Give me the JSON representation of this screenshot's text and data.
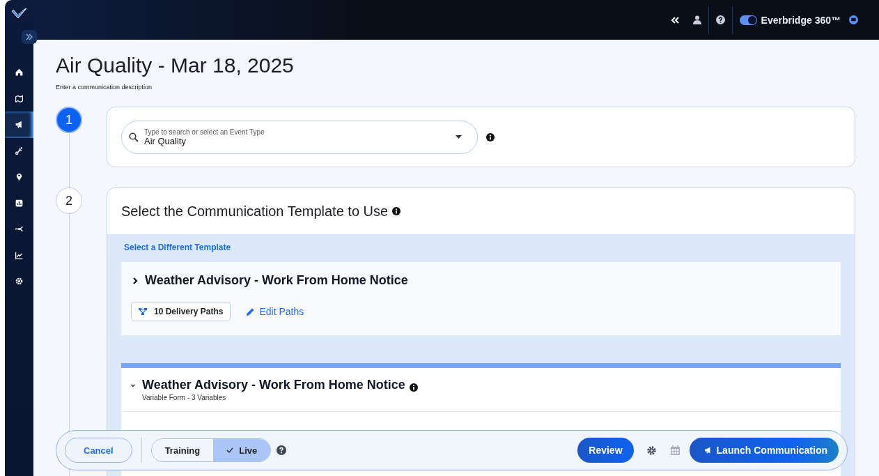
{
  "top_bar": {
    "product": "Everbridge 360™",
    "product_toggle_on": true
  },
  "sidebar": {
    "items": [
      {
        "selected": false
      },
      {
        "selected": false
      },
      {
        "selected": true
      },
      {
        "selected": false
      },
      {
        "selected": false
      },
      {
        "selected": false
      },
      {
        "selected": false
      },
      {
        "selected": false
      },
      {
        "selected": false
      }
    ]
  },
  "page": {
    "title": "Air Quality - Mar 18, 2025",
    "description": "Enter a communication description"
  },
  "steps": [
    {
      "number": "1",
      "selected": true
    },
    {
      "number": "2",
      "selected": false
    }
  ],
  "event_type": {
    "label": "Type to search or select an Event Type",
    "value": "Air Quality"
  },
  "template_section": {
    "title": "Select the Communication Template to Use",
    "link": "Select a Different Template",
    "template": {
      "name": "Weather Advisory - Work From Home Notice",
      "expanded": false,
      "delivery_paths": "10 Delivery Paths",
      "edit_link": "Edit Paths"
    }
  },
  "variable_form": {
    "name": "Weather Advisory - Work From Home Notice",
    "expanded": true,
    "subtitle": "Variable Form - 3 Variables"
  },
  "bottom_bar": {
    "cancel": "Cancel",
    "modes": [
      {
        "label": "Training",
        "selected": false
      },
      {
        "label": "Live",
        "selected": true
      }
    ],
    "review": "Review",
    "launch": "Launch Communication"
  }
}
